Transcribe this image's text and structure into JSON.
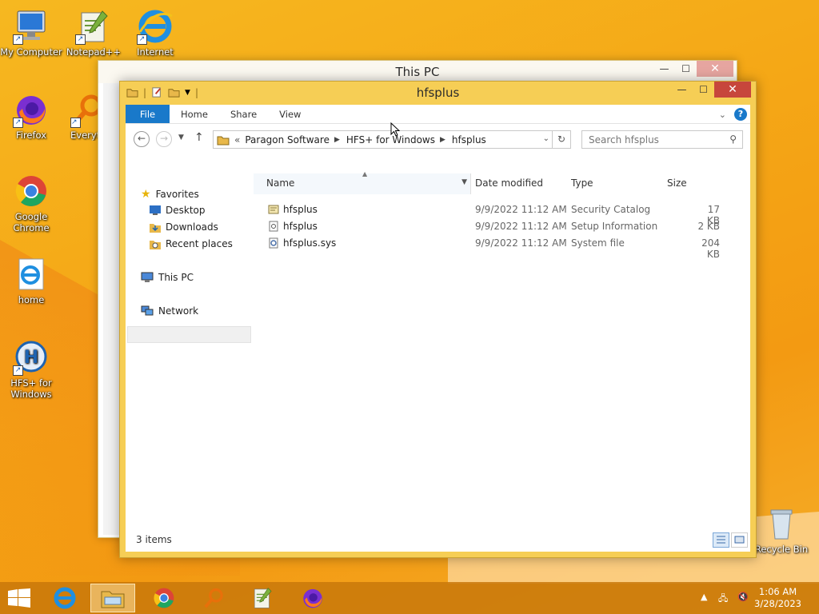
{
  "desktop": {
    "icons": [
      {
        "label": "My Computer"
      },
      {
        "label": "Notepad++"
      },
      {
        "label": "Internet"
      },
      {
        "label": "Firefox"
      },
      {
        "label": "Everyt"
      },
      {
        "label": "Google Chrome"
      },
      {
        "label": "home"
      },
      {
        "label": "HFS+ for Windows"
      },
      {
        "label": "Recycle Bin"
      }
    ]
  },
  "back_window": {
    "title": "This PC"
  },
  "window": {
    "title": "hfsplus",
    "ribbon_tabs": [
      "File",
      "Home",
      "Share",
      "View"
    ],
    "address": {
      "overflow": "«",
      "crumbs": [
        "Paragon Software",
        "HFS+ for Windows",
        "hfsplus"
      ]
    },
    "search_placeholder": "Search hfsplus",
    "nav": {
      "favorites": "Favorites",
      "desktop": "Desktop",
      "downloads": "Downloads",
      "recent": "Recent places",
      "thispc": "This PC",
      "network": "Network"
    },
    "columns": {
      "name": "Name",
      "date": "Date modified",
      "type": "Type",
      "size": "Size"
    },
    "files": [
      {
        "name": "hfsplus",
        "date": "9/9/2022 11:12 AM",
        "type": "Security Catalog",
        "size": "17 KB"
      },
      {
        "name": "hfsplus",
        "date": "9/9/2022 11:12 AM",
        "type": "Setup Information",
        "size": "2 KB"
      },
      {
        "name": "hfsplus.sys",
        "date": "9/9/2022 11:12 AM",
        "type": "System file",
        "size": "204 KB"
      }
    ],
    "status": "3 items"
  },
  "taskbar": {
    "time": "1:06 AM",
    "date": "3/28/2023"
  },
  "colors": {
    "accent": "#1979ca",
    "frame": "#f6ce55",
    "close": "#c7463c"
  }
}
